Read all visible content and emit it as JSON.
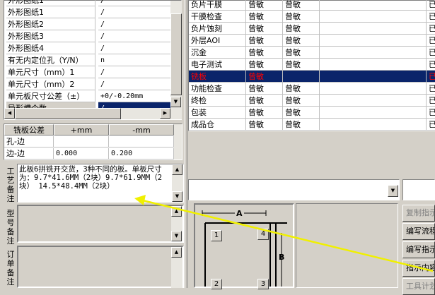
{
  "property_grid": {
    "rows": [
      {
        "name": "外形图纸1",
        "value": "/"
      },
      {
        "name": "外形图纸2",
        "value": "/"
      },
      {
        "name": "外形图纸3",
        "value": "/"
      },
      {
        "name": "外形图纸4",
        "value": "/"
      },
      {
        "name": "有无内定位孔（Y/N）",
        "value": "n"
      },
      {
        "name": "单元尺寸（mm）1",
        "value": "/"
      },
      {
        "name": "单元尺寸（mm）2",
        "value": "/"
      },
      {
        "name": "单元板尺寸公差（±）",
        "value": "+0/-0.20mm"
      },
      {
        "name": "异形槽个数",
        "value": "/"
      }
    ]
  },
  "tolerance_table": {
    "headers": [
      "铣板公差",
      "+mm",
      "-mm"
    ],
    "rows": [
      {
        "label": "孔-边",
        "plus": "",
        "minus": ""
      },
      {
        "label": "边-边",
        "plus": "0.000",
        "minus": "0.200"
      }
    ]
  },
  "memos": {
    "process_label": "工艺备注",
    "process_text": "此板6拼铣开交货，3种不同的板。单板尺寸为：9.7*41.6MM（2块）9.7*61.9MM（2块） 14.5*48.4MM（2块）",
    "model_label": "型号备注",
    "order_label": "订单备注"
  },
  "process_table": {
    "rows": [
      {
        "step": "负片干膜",
        "c1": "曾敏",
        "c2": "曾敏",
        "c3": "",
        "status": "已"
      },
      {
        "step": "干膜检查",
        "c1": "曾敏",
        "c2": "曾敏",
        "c3": "",
        "status": "已"
      },
      {
        "step": "负片蚀刻",
        "c1": "曾敏",
        "c2": "曾敏",
        "c3": "",
        "status": "已"
      },
      {
        "step": "外层AOI",
        "c1": "曾敏",
        "c2": "曾敏",
        "c3": "",
        "status": "已"
      },
      {
        "step": "沉金",
        "c1": "曾敏",
        "c2": "曾敏",
        "c3": "",
        "status": "已"
      },
      {
        "step": "电子测试",
        "c1": "曾敏",
        "c2": "曾敏",
        "c3": "",
        "status": "已"
      },
      {
        "step": "铣板",
        "c1": "曾敏",
        "c2": "",
        "c3": "",
        "status": "已"
      },
      {
        "step": "功能检查",
        "c1": "曾敏",
        "c2": "曾敏",
        "c3": "",
        "status": "已"
      },
      {
        "step": "终检",
        "c1": "曾敏",
        "c2": "曾敏",
        "c3": "",
        "status": "已"
      },
      {
        "step": "包装",
        "c1": "曾敏",
        "c2": "曾敏",
        "c3": "",
        "status": "已"
      },
      {
        "step": "成品仓",
        "c1": "曾敏",
        "c2": "曾敏",
        "c3": "",
        "status": "已"
      }
    ],
    "selected_index": 6
  },
  "drawing": {
    "label_a": "A",
    "label_b": "B",
    "markers": [
      "1",
      "4",
      "2",
      "3"
    ]
  },
  "buttons": [
    {
      "label": "复制指示",
      "enabled": false
    },
    {
      "label": "编写流程",
      "enabled": true
    },
    {
      "label": "编写指示",
      "enabled": true
    },
    {
      "label": "指示内容",
      "enabled": true
    },
    {
      "label": "工具计划",
      "enabled": false
    }
  ],
  "colors": {
    "window_bg": "#d4d0c8",
    "selection": "#0a246a",
    "selected_text": "#ff0000",
    "annotation_arrow": "#f0f000"
  }
}
